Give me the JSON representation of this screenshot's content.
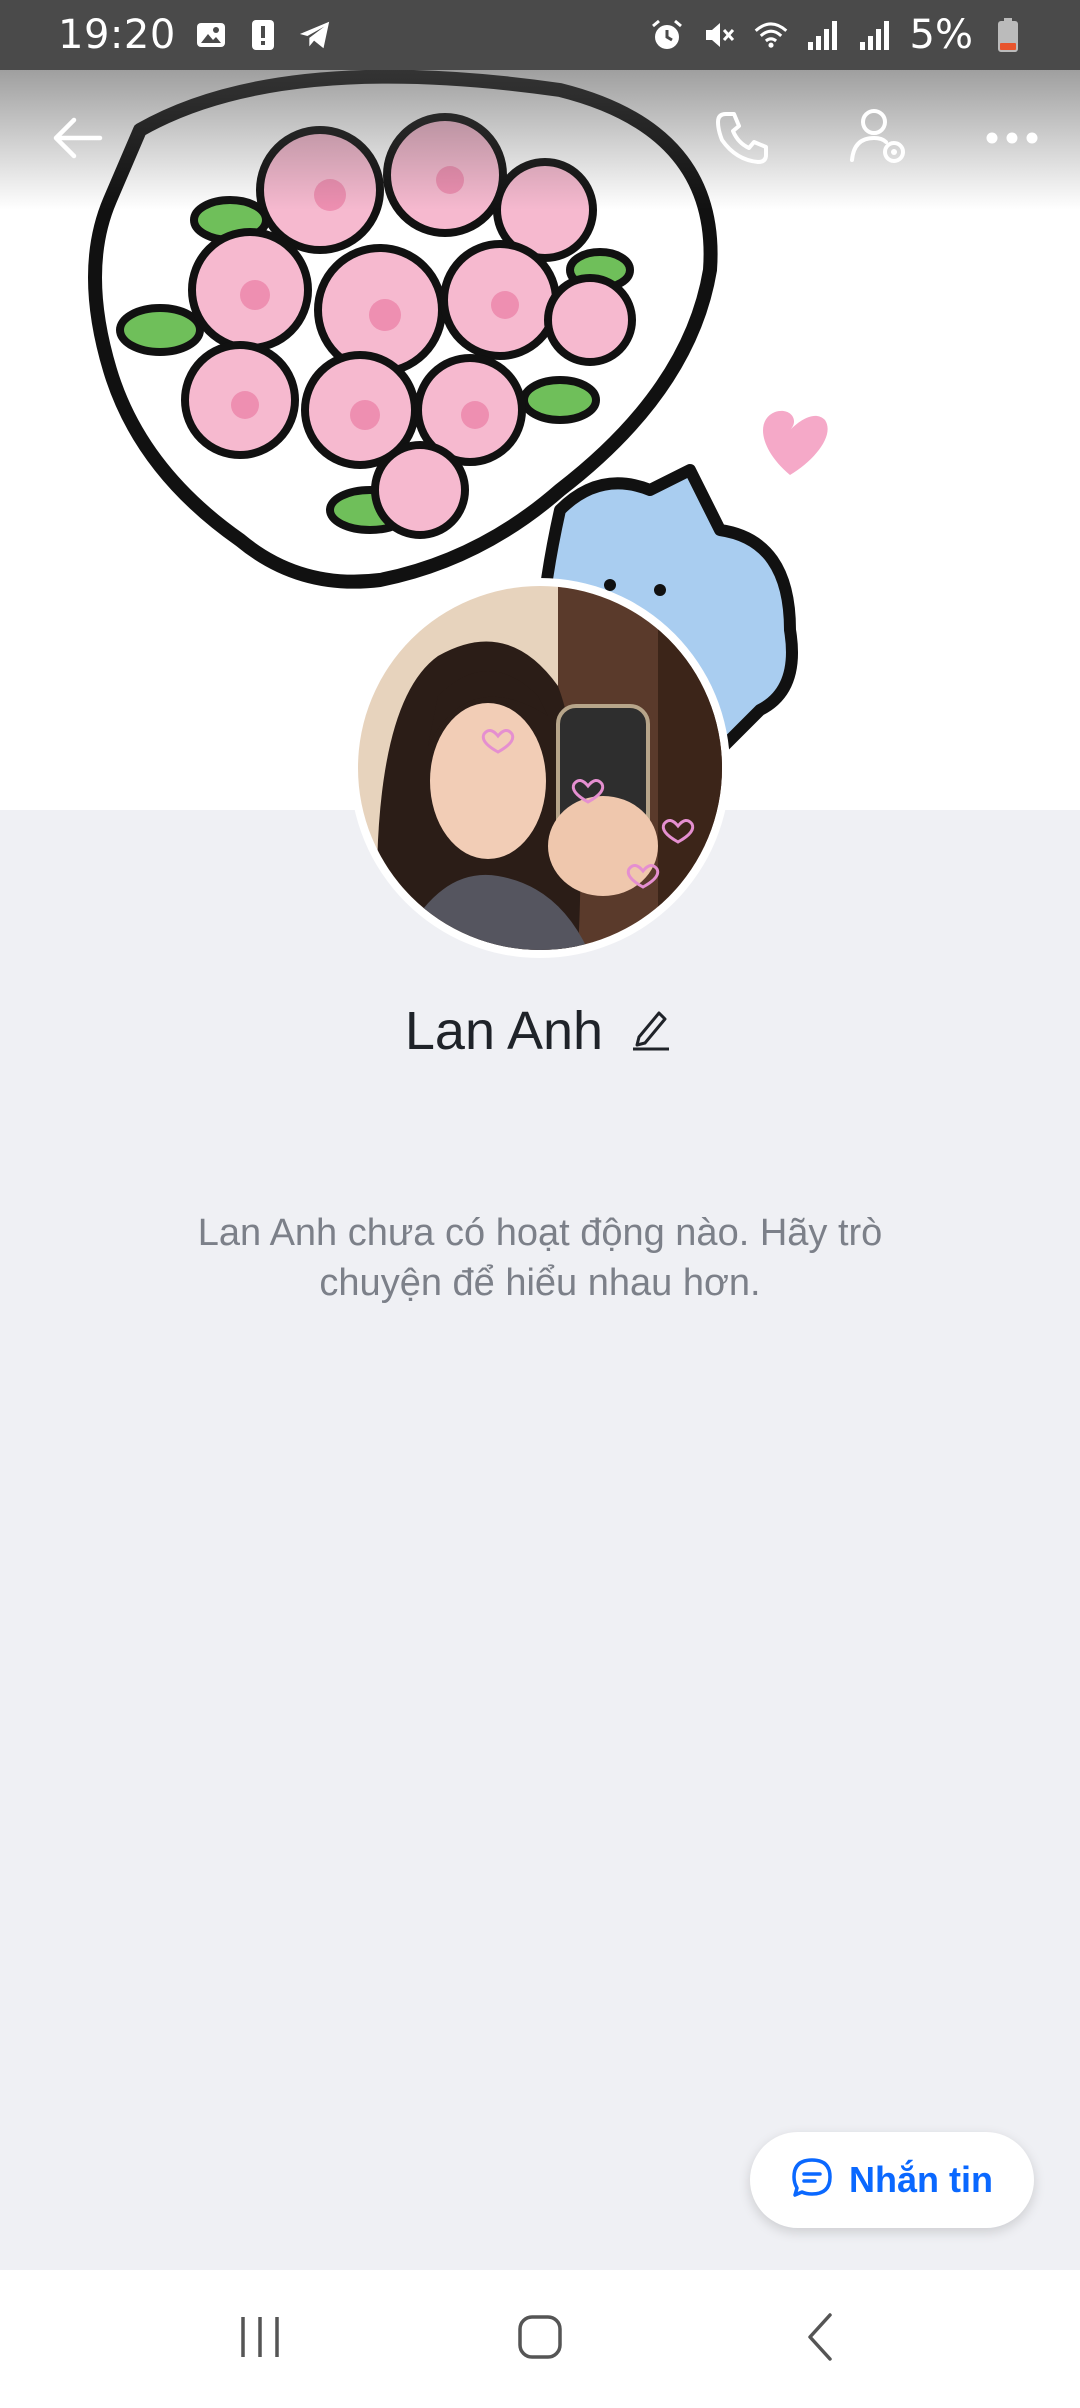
{
  "status_bar": {
    "time": "19:20",
    "battery_percent": "5%",
    "icons_left": [
      "gallery-icon",
      "alert-icon",
      "telegram-icon"
    ],
    "icons_right": [
      "alarm-icon",
      "mute-icon",
      "wifi-icon",
      "signal-icon",
      "signal-icon",
      "battery-icon"
    ]
  },
  "header": {
    "actions": [
      "back-icon",
      "call-icon",
      "user-settings-icon",
      "more-icon"
    ]
  },
  "profile": {
    "name": "Lan Anh",
    "activity_message": "Lan Anh chưa có hoạt động nào. Hãy trò chuyện để hiểu nhau hơn."
  },
  "message_button": {
    "label": "Nhắn tin"
  },
  "nav": [
    "recents-icon",
    "home-icon",
    "back-nav-icon"
  ],
  "colors": {
    "accent": "#0a68ff",
    "background": "#eff0f4",
    "text_primary": "#1f2329",
    "text_secondary": "#7c8089"
  }
}
